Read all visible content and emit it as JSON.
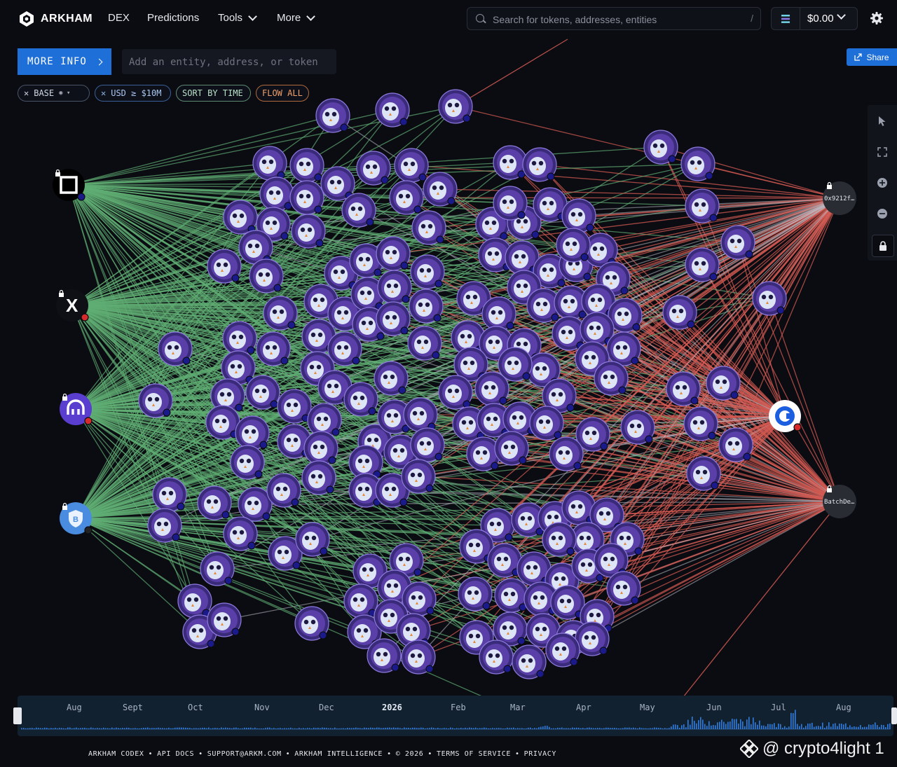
{
  "brand": {
    "name": "ARKHAM"
  },
  "nav": {
    "items": [
      {
        "label": "DEX",
        "dropdown": false
      },
      {
        "label": "Predictions",
        "dropdown": false
      },
      {
        "label": "Tools",
        "dropdown": true
      },
      {
        "label": "More",
        "dropdown": true
      }
    ]
  },
  "search": {
    "placeholder": "Search for tokens, addresses, entities",
    "shortcut": "/"
  },
  "wallet": {
    "balance": "$0.00"
  },
  "toolbar": {
    "more_info_label": "MORE INFO",
    "entity_placeholder": "Add an entity, address, or token",
    "share_label": "Share"
  },
  "filters": [
    {
      "label": "BASE",
      "removable": true,
      "style": "plain"
    },
    {
      "label": "USD ≥ $10M",
      "removable": true,
      "style": "blue"
    },
    {
      "label": "SORT BY TIME",
      "removable": false,
      "style": "green"
    },
    {
      "label": "FLOW ALL",
      "removable": false,
      "style": "orange"
    }
  ],
  "graph": {
    "left_entities": [
      "okx-icon",
      "x-exchange-icon",
      "kraken-icon",
      "shield-b-icon"
    ],
    "right_entities": [
      {
        "label": "0x9212f…",
        "icon": "address-node"
      },
      {
        "label": "",
        "icon": "coinbase-icon"
      },
      {
        "label": "BatchDe…",
        "icon": "address-node"
      }
    ],
    "colors": {
      "inflow": "#5fae73",
      "outflow": "#d35a52",
      "neutral": "#b9bcc4",
      "node": "#5b3fa8"
    }
  },
  "timeline": {
    "labels": [
      "Aug",
      "Sept",
      "Oct",
      "Nov",
      "Dec",
      "2026",
      "Feb",
      "Mar",
      "Apr",
      "May",
      "Jun",
      "Jul",
      "Aug"
    ]
  },
  "footer": {
    "links": [
      "ARKHAM CODEX",
      "API DOCS",
      "SUPPORT@ARKM.COM",
      "ARKHAM INTELLIGENCE",
      "© 2026",
      "TERMS OF SERVICE",
      "PRIVACY"
    ]
  },
  "watermark": {
    "text": "@ crypto4light 1"
  }
}
